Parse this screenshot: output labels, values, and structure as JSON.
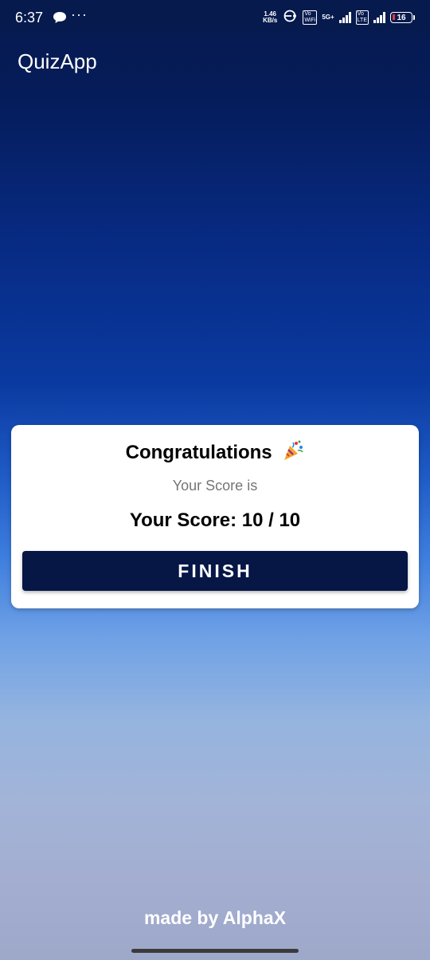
{
  "status_bar": {
    "time": "6:37",
    "speed_value": "1.46",
    "speed_unit": "KB/s",
    "sim1_label": "Vo\nWiFi",
    "network": "5G+",
    "sim2_label": "Vo\nLTE",
    "battery_level": "16",
    "icons": [
      "chat-bubble-icon",
      "more-dots-icon",
      "hotspot-icon",
      "signal-icon",
      "battery-icon"
    ],
    "battery_color": "#e53935"
  },
  "app_bar": {
    "title": "QuizApp"
  },
  "result_card": {
    "title": "Congratulations",
    "emoji": "party-popper-icon",
    "subtitle": "Your Score is",
    "score_text": "Your Score: 10 / 10",
    "score": 10,
    "total": 10,
    "finish_label": "FINISH"
  },
  "footer": {
    "credit": "made by AlphaX"
  },
  "colors": {
    "primary_dark": "#061645",
    "status_bar_bg": "#061a4e",
    "card_bg": "#ffffff",
    "subtitle_gray": "#757575"
  }
}
